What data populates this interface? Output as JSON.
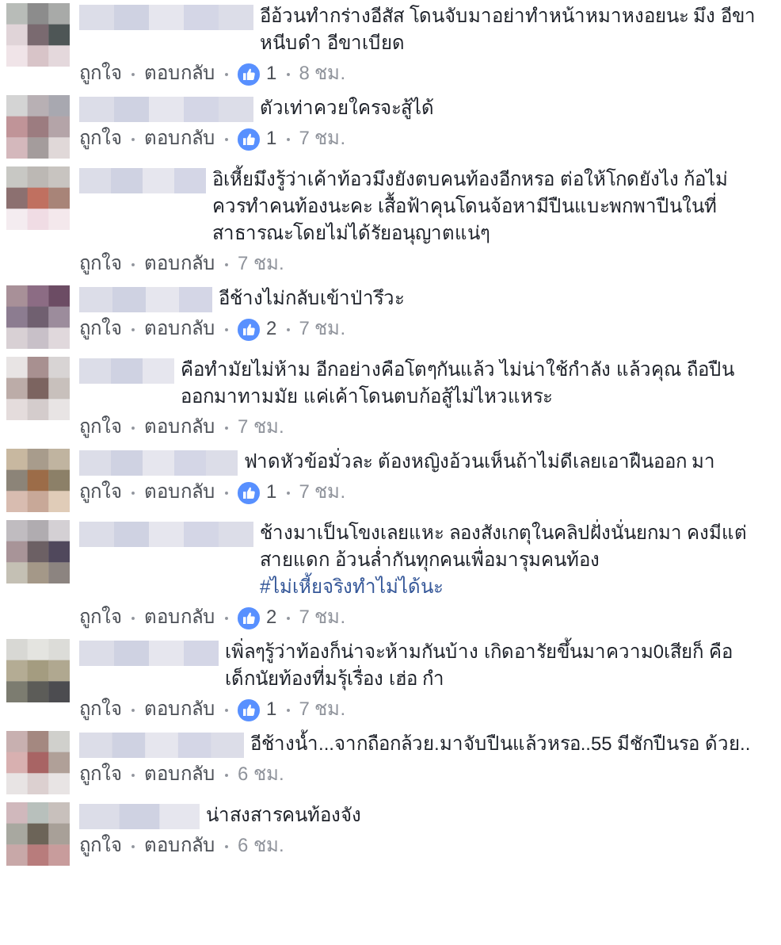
{
  "comments": [
    {
      "text": "อีอ้วนทำกร่างอีสัส โดนจับมาอย่าทำหน้าหมาหงอยนะ มึง อีขาหนีบดำ อีขาเบียด",
      "like": "ถูกใจ",
      "reply": "ตอบกลับ",
      "likes": "1",
      "time": "8 ชม."
    },
    {
      "text": "ตัวเท่าควยใครจะสู้ได้",
      "like": "ถูกใจ",
      "reply": "ตอบกลับ",
      "likes": "1",
      "time": "7 ชม."
    },
    {
      "text": "อิเหี้ยมึงรู้ว่าเค้าท้อวมึงยังตบคนท้องอีกหรอ ต่อให้โกดยังไง ก้อไม่ควรทำคนท้องนะคะ เสื้อฟ้าคุนโดนจ้อหามีปืนแบะพกพาปืนในที่ สาธารณะโดยไม่ได้รัยอนุญาตแน่ๆ",
      "like": "ถูกใจ",
      "reply": "ตอบกลับ",
      "time": "7 ชม."
    },
    {
      "text": "อีช้างไม่กลับเข้าป่ารึวะ",
      "like": "ถูกใจ",
      "reply": "ตอบกลับ",
      "likes": "2",
      "time": "7 ชม."
    },
    {
      "text": "คือทำมัยไม่ห้าม อีกอย่างคือโตๆกันแล้ว ไม่น่าใช้กำลัง แล้วคุณ ถือปืนออกมาทามมัย แค่เค้าโดนตบก้อสู้ไม่ไหวแหระ",
      "like": "ถูกใจ",
      "reply": "ตอบกลับ",
      "time": "7 ชม."
    },
    {
      "text": "ฟาดหัวข้อมั่วละ ต้องหญิงอ้วนเห็นถ้าไม่ดีเลยเอาฝืนออก มา",
      "like": "ถูกใจ",
      "reply": "ตอบกลับ",
      "likes": "1",
      "time": "7 ชม."
    },
    {
      "text": "ช้างมาเป็นโขงเลยแหะ ลองสังเกตุในคลิปฝั่งนั่นยกมา คงมีแต่สายแดก อ้วนล่ำกันทุกคนเพื่อมารุมคนท้อง",
      "hashtag": "#ไม่เหี้ยจริงทำไม่ได้นะ",
      "like": "ถูกใจ",
      "reply": "ตอบกลับ",
      "likes": "2",
      "time": "7 ชม."
    },
    {
      "text": "เพิ่ลๆรู้ว่าท้องก็น่าจะห้ามกันบ้าง เกิดอารัยขึ้นมาความ0เสียก็ คือเด็กนัยท้องที่มรุ้เรื่อง เฮ่อ กำ",
      "like": "ถูกใจ",
      "reply": "ตอบกลับ",
      "likes": "1",
      "time": "7 ชม."
    },
    {
      "text": "อีช้างน้ำ...จากถือกล้วย.มาจับปืนแล้วหรอ..55 มีชักปืนรอ ด้วย..",
      "like": "ถูกใจ",
      "reply": "ตอบกลับ",
      "time": "6 ชม."
    },
    {
      "text": "น่าสงสารคนท้องจัง",
      "like": "ถูกใจ",
      "reply": "ตอบกลับ",
      "time": "6 ชม."
    }
  ]
}
